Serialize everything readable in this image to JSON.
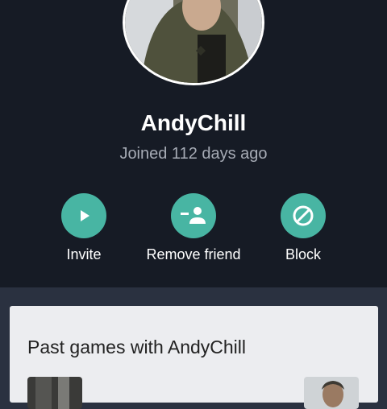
{
  "profile": {
    "username": "AndyChill",
    "joined": "Joined 112 days ago"
  },
  "actions": [
    {
      "label": "Invite",
      "icon": "play-icon"
    },
    {
      "label": "Remove friend",
      "icon": "remove-friend-icon"
    },
    {
      "label": "Block",
      "icon": "block-icon"
    }
  ],
  "past_games": {
    "title": "Past games with AndyChill"
  },
  "colors": {
    "profile_bg": "#161b25",
    "page_bg": "#2a3140",
    "accent": "#48b5a3",
    "card_bg": "#ecedf0"
  }
}
